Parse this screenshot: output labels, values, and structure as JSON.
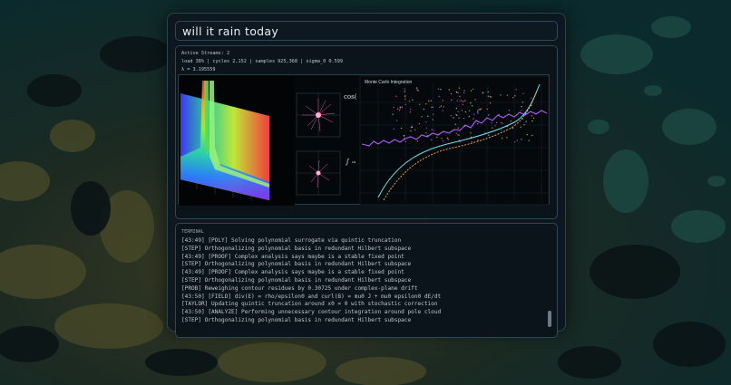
{
  "app": {
    "title": "will it rain today"
  },
  "stats": {
    "line1": "Active Streams: 2",
    "line2": "load 38% | cycles 2,152 | samples 925,368 | sigma_0 0.599",
    "line3": "λ = 3.195559"
  },
  "viz": {
    "formula1": "cos(",
    "formula2": "∫",
    "formula2_suffix": "ca",
    "chart_title": "Monte Carlo Integration"
  },
  "terminal": {
    "header": "TERMINAL",
    "lines": [
      "[43:49] [POLY] Solving polynomial surrogate via quintic truncation",
      "[STEP] Orthogonalizing polynomial basis in redundant Hilbert subspace",
      "[43:49] [PROOF] Complex analysis says maybe is a stable fixed point",
      "[STEP] Orthogonalizing polynomial basis in redundant Hilbert subspace",
      "[43:49] [PROOF] Complex analysis says maybe is a stable fixed point",
      "[STEP] Orthogonalizing polynomial basis in redundant Hilbert subspace",
      "[PROB] Reweighing contour residues by 0.30725 under complex-plane drift",
      "[43:50] [FIELD] div(E) = rho/epsilon0 and curl(B) = mu0 J + mu0 epsilon0 dE/dt",
      "[TAYLOR] Updating quintic truncation around x0 = 0 with stochastic correction",
      "[43:50] [ANALYZE] Performing unnecessary contour integration around pole cloud",
      "[STEP] Orthogonalizing polynomial basis in redundant Hilbert subspace"
    ]
  },
  "colors": {
    "panel_border": "#2b4452",
    "accent_cyan": "#6fe3e8",
    "accent_purple": "#b05cff",
    "accent_pink": "#ff6fb0",
    "accent_orange": "#ffb050"
  }
}
